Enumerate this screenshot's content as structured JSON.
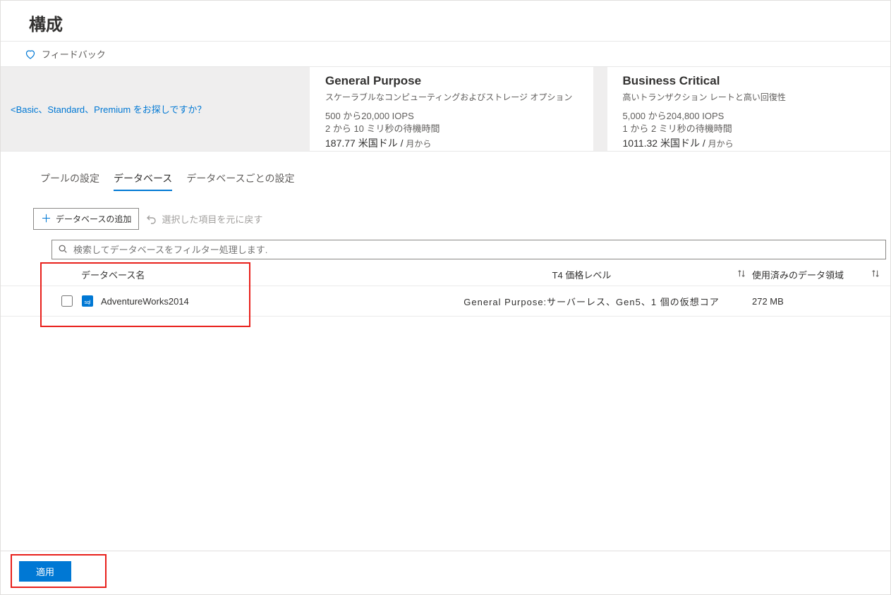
{
  "header": {
    "title": "構成"
  },
  "feedback": {
    "label": "フィードバック"
  },
  "tiers": {
    "legacy_link": "<Basic、Standard、Premium をお探しですか？",
    "general_purpose": {
      "title": "General Purpose",
      "subtitle": "スケーラブルなコンピューティングおよびストレージ オプション",
      "iops": "500 から20,000 IOPS",
      "latency": "2 から 10 ミリ秒の待機時間",
      "price": "187.77 米国ドル /",
      "price_suffix": "月から"
    },
    "business_critical": {
      "title": "Business Critical",
      "subtitle": "高いトランザクション レートと高い回復性",
      "iops": "5,000 から204,800 IOPS",
      "latency": "1 から 2 ミリ秒の待機時間",
      "price": "1011.32 米国ドル /",
      "price_suffix": "月から"
    }
  },
  "subtabs": {
    "pool_settings": "プールの設定",
    "databases": "データベース",
    "per_db_settings": "データベースごとの設定"
  },
  "toolbar": {
    "add_database": "データベースの追加",
    "undo_selection": "選択した項目を元に戻す"
  },
  "search": {
    "placeholder": "検索してデータベースをフィルター処理します."
  },
  "table": {
    "columns": {
      "database_name": "データベース名",
      "tier": "T4 価格レベル",
      "used_space": "使用済みのデータ領域"
    },
    "rows": [
      {
        "name": "AdventureWorks2014",
        "tier": "General Purpose:サーバーレス、Gen5、1 個の仮想コア",
        "used": "272 MB"
      }
    ]
  },
  "footer": {
    "apply": "適用"
  }
}
